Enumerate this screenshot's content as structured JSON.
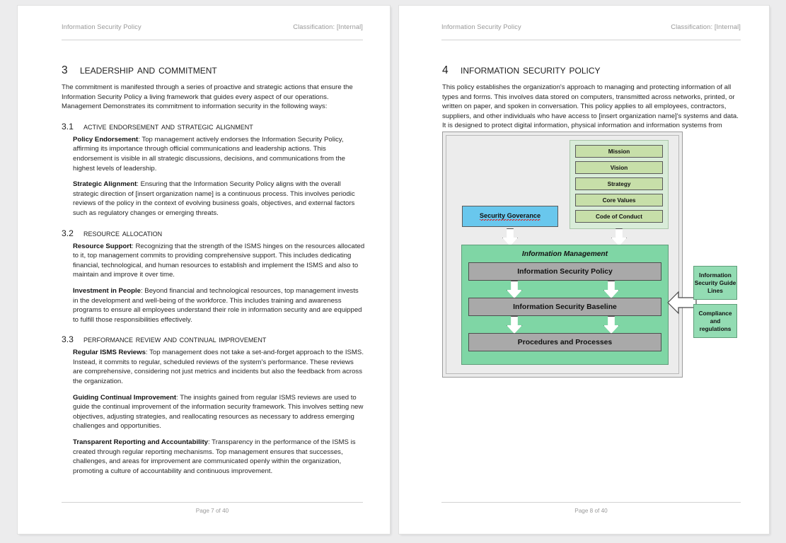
{
  "document": {
    "header_left": "Information Security Policy",
    "header_right": "Classification: [Internal]"
  },
  "page_left": {
    "footer": "Page 7 of 40",
    "section": {
      "number": "3",
      "title": "Leadership and Commitment",
      "intro": "The commitment is manifested through a series of proactive and strategic actions that ensure the Information Security Policy a living framework that guides every aspect of our operations. Management Demonstrates its commitment to information security in the following ways:"
    },
    "subsections": [
      {
        "number": "3.1",
        "title": "Active Endorsement and Strategic Alignment",
        "paragraphs": [
          {
            "runin": "Policy Endorsement",
            "text": ": Top management actively endorses the Information Security Policy, affirming its importance through official communications and leadership actions. This endorsement is visible in all strategic discussions, decisions, and communications from the highest levels of leadership."
          },
          {
            "runin": "Strategic Alignment",
            "text": ": Ensuring that the Information Security Policy aligns with the overall strategic direction of [insert organization name] is a continuous process. This involves periodic reviews of the policy in the context of evolving business goals, objectives, and external factors such as regulatory changes or emerging threats."
          }
        ]
      },
      {
        "number": "3.2",
        "title": "Resource Allocation",
        "paragraphs": [
          {
            "runin": "Resource Support",
            "text": ": Recognizing that the strength of the ISMS hinges on the resources allocated to it, top management commits to providing comprehensive support. This includes dedicating financial, technological, and human resources to establish and implement the ISMS and also to maintain and improve it over time."
          },
          {
            "runin": "Investment in People",
            "text": ": Beyond financial and technological resources, top management invests in the development and well-being of the workforce. This includes training and awareness programs to ensure all employees understand their role in information security and are equipped to fulfill those responsibilities effectively."
          }
        ]
      },
      {
        "number": "3.3",
        "title": "Performance Review and Continual Improvement",
        "paragraphs": [
          {
            "runin": "Regular ISMS Reviews",
            "text": ": Top management does not take a set-and-forget approach to the ISMS. Instead, it commits to regular, scheduled reviews of the system's performance. These reviews are comprehensive, considering not just metrics and incidents but also the feedback from across the organization."
          },
          {
            "runin": "Guiding Continual Improvement",
            "text": ": The insights gained from regular ISMS reviews are used to guide the continual improvement of the information security framework. This involves setting new objectives, adjusting strategies, and reallocating resources as necessary to address emerging challenges and opportunities."
          },
          {
            "runin": "Transparent Reporting and Accountability",
            "text": ": Transparency in the performance of the ISMS is created through regular reporting mechanisms. Top management ensures that successes, challenges, and areas for improvement are communicated openly within the organization, promoting a culture of accountability and continuous improvement."
          }
        ]
      }
    ]
  },
  "page_right": {
    "footer": "Page 8 of 40",
    "section": {
      "number": "4",
      "title": "Information Security Policy",
      "intro": "This policy establishes the organization's approach to managing and protecting information of all types and forms. This involves data stored on computers, transmitted across networks, printed, or written on paper, and spoken in conversation. This policy applies to all employees, contractors, suppliers, and other individuals who have access to [insert organization name]'s systems and data. It is designed to protect digital information, physical information and information systems from unauthorized access, use, disclosure, disruption, modification, or destruction."
    },
    "diagram": {
      "governance_box": "Security Goverance",
      "values_group": [
        "Mission",
        "Vision",
        "Strategy",
        "Core Values",
        "Code of Conduct"
      ],
      "management_group": {
        "title": "Information Management",
        "boxes": [
          "Information Security Policy",
          "Information Security Baseline",
          "Procedures and Processes"
        ]
      },
      "side_boxes": [
        "Information Security Guide Lines",
        "Compliance and regulations"
      ],
      "colors": {
        "governance": "#69c7ed",
        "values_group_bg": "#d9ecd9",
        "values_box": "#c7dfa9",
        "management_bg": "#7fd6a5",
        "management_box": "#a9a9a9",
        "side_box": "#93dcb3",
        "canvas": "#ebebeb"
      }
    }
  }
}
